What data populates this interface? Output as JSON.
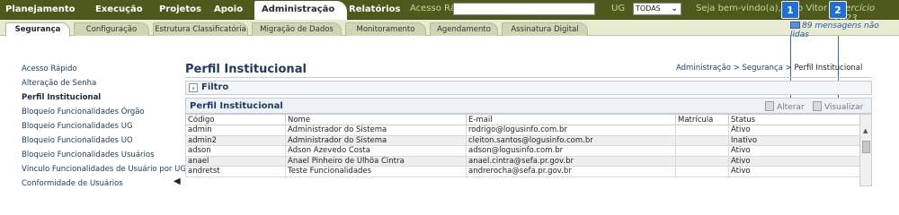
{
  "topnav": {
    "items": [
      "Planejamento",
      "Execução",
      "Projetos",
      "Apoio",
      "Administração",
      "Relatórios"
    ],
    "active": "Administração",
    "quick_access_label": "Acesso Rápido",
    "quick_access_value": "",
    "ug_label": "UG",
    "ug_value": "TODAS",
    "welcome": "Seja bem-vindo(a), Joao Vitor",
    "year_label": "Exercício 2023"
  },
  "annotations": [
    "1",
    "2"
  ],
  "subtabs": {
    "items": [
      "Segurança",
      "Configuração",
      "Estrutura Classificatória",
      "Migração de Dados",
      "Monitoramento",
      "Agendamento",
      "Assinatura Digital"
    ],
    "active": "Segurança"
  },
  "messages": "89 mensagens não lidas",
  "sidebar": {
    "items": [
      "Acesso Rápido",
      "Alteração de Senha",
      "Perfil Institucional",
      "Bloqueio Funcionalidades Órgão",
      "Bloqueio Funcionalidades UG",
      "Bloqueio Funcionalidades UO",
      "Bloqueio Funcionalidades Usuários",
      "Vínculo Funcionalidades de Usuário por UG",
      "Conformidade de Usuários"
    ],
    "active": "Perfil Institucional"
  },
  "page": {
    "title": "Perfil Institucional",
    "breadcrumb": [
      "Administração",
      "Segurança",
      "Perfil Institucional"
    ],
    "breadcrumb_sep": ">",
    "filter_label": "Filtro",
    "filter_toggle": "›",
    "grid_title": "Perfil Institucional",
    "actions": {
      "edit": "Alterar",
      "view": "Visualizar"
    }
  },
  "table": {
    "columns": [
      "Código",
      "Nome",
      "E-mail",
      "Matrícula",
      "Status"
    ],
    "rows": [
      [
        "admin",
        "Administrador do Sistema",
        "rodrigo@logusinfo.com.br",
        "",
        "Ativo"
      ],
      [
        "admin2",
        "Administrador do Sistema",
        "cleiton.santos@logusinfo.com.br",
        "",
        "Inativo"
      ],
      [
        "adson",
        "Adson Azevedo Costa",
        "adson@logusinfo.com.br",
        "",
        "Ativo"
      ],
      [
        "anael",
        "Anael Pinheiro de Ulhôa Cintra",
        "anael.cintra@sefa.pr.gov.br",
        "",
        "Ativo"
      ],
      [
        "andretst",
        "Teste Funcionalidades",
        "andrerocha@sefa.pr.gov.br",
        "",
        "Ativo"
      ]
    ]
  },
  "colors": {
    "topbar": "#4d5a1b",
    "subbar": "#e6ebd2",
    "title": "#1d3b66",
    "link": "#1b3f73",
    "badge": "#1f6fd6"
  }
}
